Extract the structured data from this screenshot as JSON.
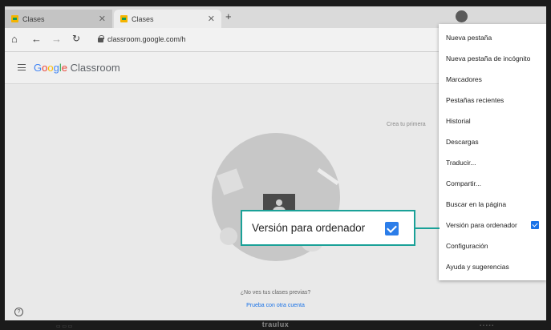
{
  "browser": {
    "tabs": [
      {
        "label": "Clases"
      },
      {
        "label": "Clases"
      }
    ],
    "url": "classroom.google.com/h"
  },
  "app": {
    "logo_google": [
      "G",
      "o",
      "o",
      "g",
      "l",
      "e"
    ],
    "logo_product": "Classroom",
    "create_hint": "Crea tu primera",
    "no_classes": "¿No ves tus clases previas?",
    "other_account": "Prueba con otra cuenta"
  },
  "menu": {
    "items": [
      {
        "label": "Nueva pestaña"
      },
      {
        "label": "Nueva pestaña de incógnito"
      },
      {
        "label": "Marcadores"
      },
      {
        "label": "Pestañas recientes"
      },
      {
        "label": "Historial"
      },
      {
        "label": "Descargas"
      },
      {
        "label": "Traducir..."
      },
      {
        "label": "Compartir..."
      },
      {
        "label": "Buscar en la página"
      },
      {
        "label": "Versión para ordenador",
        "checked": true
      },
      {
        "label": "Configuración"
      },
      {
        "label": "Ayuda y sugerencias"
      }
    ]
  },
  "callout": {
    "label": "Versión para ordenador",
    "checked": true
  },
  "bezel": {
    "brand": "traulux"
  },
  "colors": {
    "callout_border": "#1aa198",
    "checkbox_blue": "#1a73e8"
  }
}
